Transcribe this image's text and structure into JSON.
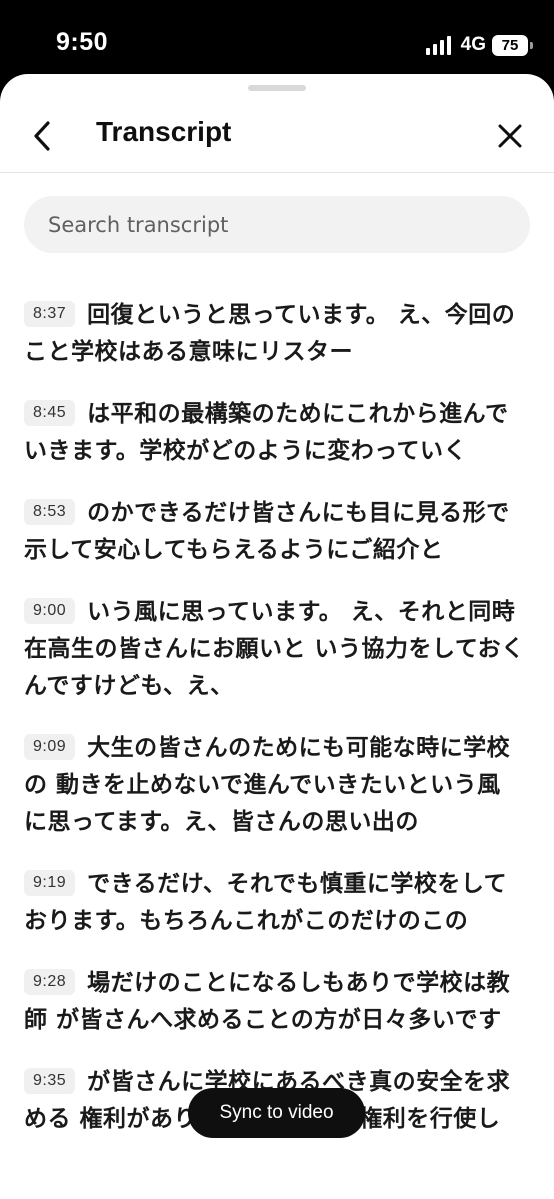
{
  "status_bar": {
    "time": "9:50",
    "network": "4G",
    "battery": "75"
  },
  "header": {
    "title": "Transcript"
  },
  "search": {
    "placeholder": "Search transcript"
  },
  "segments": [
    {
      "time": "8:37",
      "text": "回復というと思っています。 え、今回のこと学校はある意味にリスター"
    },
    {
      "time": "8:45",
      "text": "は平和の最構築のためにこれから進んで いきます。学校がどのように変わっていく"
    },
    {
      "time": "8:53",
      "text": "のかできるだけ皆さんにも目に見る形で 示して安心してもらえるようにご紹介と"
    },
    {
      "time": "9:00",
      "text": "いう風に思っています。 え、それと同時在高生の皆さんにお願いと いう協力をしておくんですけども、え、"
    },
    {
      "time": "9:09",
      "text": "大生の皆さんのためにも可能な時に学校の 動きを止めないで進んでいきたいという風 に思ってます。え、皆さんの思い出の"
    },
    {
      "time": "9:19",
      "text": "できるだけ、それでも慎重に学校をして おります。もちろんこれがこのだけのこの"
    },
    {
      "time": "9:28",
      "text": "場だけのことになるしもありで学校は教師 が皆さんへ求めることの方が日々多いです"
    },
    {
      "time": "9:35",
      "text": "が皆さんに学校にあるべき真の安全を求める 権利があります。是非その権利を行使し"
    }
  ],
  "sync_button": {
    "label": "Sync to video"
  }
}
